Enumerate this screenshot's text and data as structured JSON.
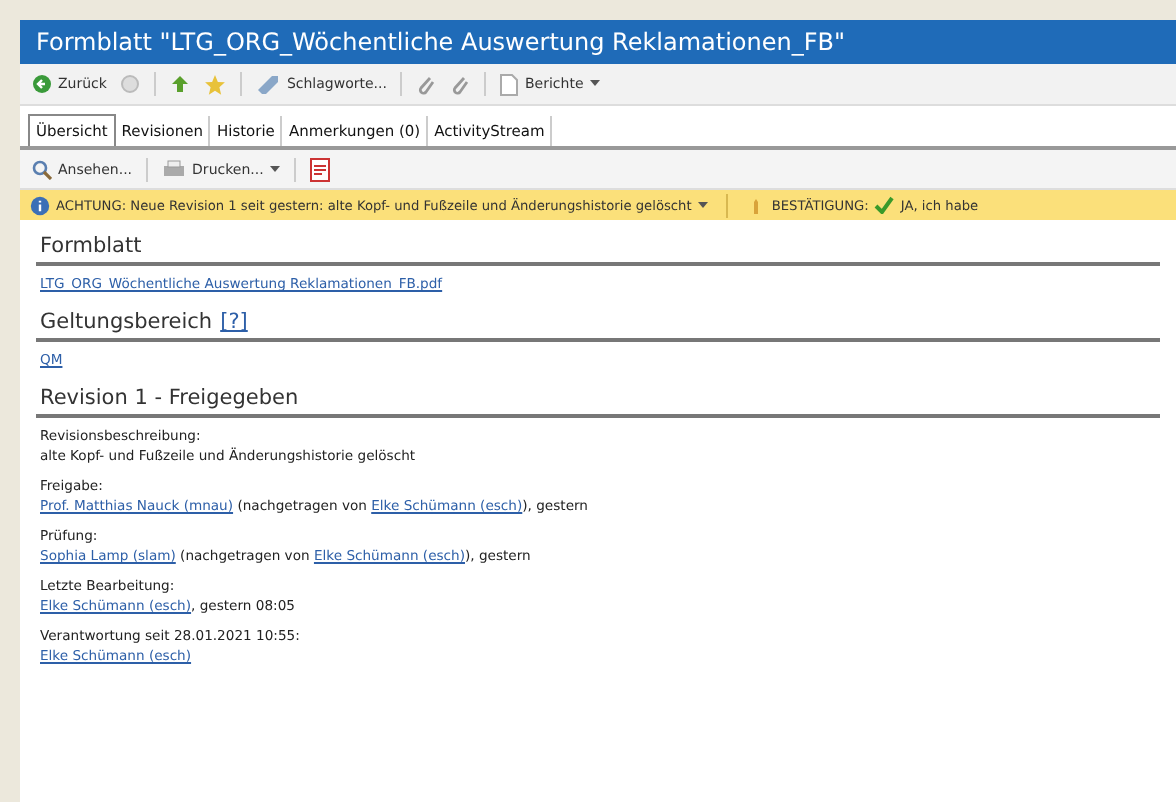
{
  "window": {
    "title": "Formblatt \"LTG_ORG_Wöchentliche Auswertung Reklamationen_FB\""
  },
  "toolbar": [
    {
      "kind": "back",
      "label": "Zurück"
    },
    {
      "kind": "disc"
    },
    {
      "kind": "sep"
    },
    {
      "kind": "up"
    },
    {
      "kind": "star"
    },
    {
      "kind": "sep"
    },
    {
      "kind": "tag",
      "label": "Schlagworte..."
    },
    {
      "kind": "sep"
    },
    {
      "kind": "clip"
    },
    {
      "kind": "clip"
    },
    {
      "kind": "sep"
    },
    {
      "kind": "doc",
      "label": "Berichte",
      "dropdown": true
    }
  ],
  "tabs": [
    {
      "label": "Übersicht",
      "selected": true
    },
    {
      "label": "Revisionen",
      "selected": false
    },
    {
      "label": "Historie",
      "selected": false
    },
    {
      "label": "Anmerkungen (0)",
      "selected": false
    },
    {
      "label": "ActivityStream",
      "selected": false
    }
  ],
  "subtoolbar": [
    {
      "kind": "search",
      "label": "Ansehen..."
    },
    {
      "kind": "print",
      "label": "Drucken...",
      "dropdown": true
    },
    {
      "kind": "pdf"
    }
  ],
  "notice": {
    "warning": "ACHTUNG:  Neue Revision 1 seit gestern: alte Kopf- und Fußzeile und Änderungshistorie gelöscht",
    "confirm_label": "BESTÄTIGUNG:",
    "confirm_text": "JA, ich habe"
  },
  "sections": [
    {
      "title": "Formblatt",
      "blocks": [
        {
          "lines": [
            [
              {
                "kind": "link",
                "text": "LTG_ORG_Wöchentliche Auswertung Reklamationen_FB.pdf"
              }
            ]
          ]
        }
      ]
    },
    {
      "title": "Geltungsbereich",
      "help": "[?]",
      "blocks": [
        {
          "lines": [
            [
              {
                "kind": "link",
                "text": "QM"
              }
            ]
          ]
        }
      ]
    },
    {
      "title": "Revision 1 - Freigegeben",
      "blocks": [
        {
          "label": "Revisionsbeschreibung:",
          "lines": [
            [
              {
                "kind": "text",
                "text": "alte Kopf- und Fußzeile und Änderungshistorie gelöscht"
              }
            ]
          ]
        },
        {
          "label": "Freigabe:",
          "lines": [
            [
              {
                "kind": "link",
                "text": "Prof. Matthias Nauck (mnau)"
              },
              {
                "kind": "text",
                "text": " (nachgetragen von "
              },
              {
                "kind": "link",
                "text": "Elke Schümann (esch)"
              },
              {
                "kind": "text",
                "text": "), gestern"
              }
            ]
          ]
        },
        {
          "label": "Prüfung:",
          "lines": [
            [
              {
                "kind": "link",
                "text": "Sophia Lamp (slam)"
              },
              {
                "kind": "text",
                "text": " (nachgetragen von "
              },
              {
                "kind": "link",
                "text": "Elke Schümann (esch)"
              },
              {
                "kind": "text",
                "text": "), gestern"
              }
            ]
          ]
        },
        {
          "label": "Letzte Bearbeitung:",
          "lines": [
            [
              {
                "kind": "link",
                "text": "Elke Schümann (esch)"
              },
              {
                "kind": "text",
                "text": ", gestern 08:05"
              }
            ]
          ]
        },
        {
          "label": "Verantwortung seit 28.01.2021 10:55:",
          "lines": [
            [
              {
                "kind": "link",
                "text": "Elke Schümann (esch)"
              }
            ]
          ]
        }
      ]
    }
  ]
}
